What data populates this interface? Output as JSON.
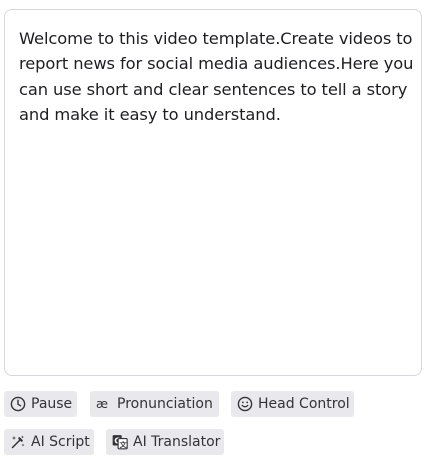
{
  "editor": {
    "script_text": "Welcome to this video template.Create videos to report news for social media audiences.Here you can use short and clear sentences to tell a story and make it easy to understand."
  },
  "toolbar": {
    "pause": {
      "label": "Pause",
      "icon": "clock-icon"
    },
    "pronunciation": {
      "label": "Pronunciation",
      "icon": "ae-ligature-icon"
    },
    "head_control": {
      "label": "Head Control",
      "icon": "smiley-face-icon"
    },
    "ai_script": {
      "label": "AI Script",
      "icon": "magic-wand-icon"
    },
    "ai_translator": {
      "label": "AI Translator",
      "icon": "translate-icon"
    }
  },
  "colors": {
    "chip_background": "#e9e8ed",
    "box_border": "#d7d7dc",
    "text": "#1e1e22"
  }
}
